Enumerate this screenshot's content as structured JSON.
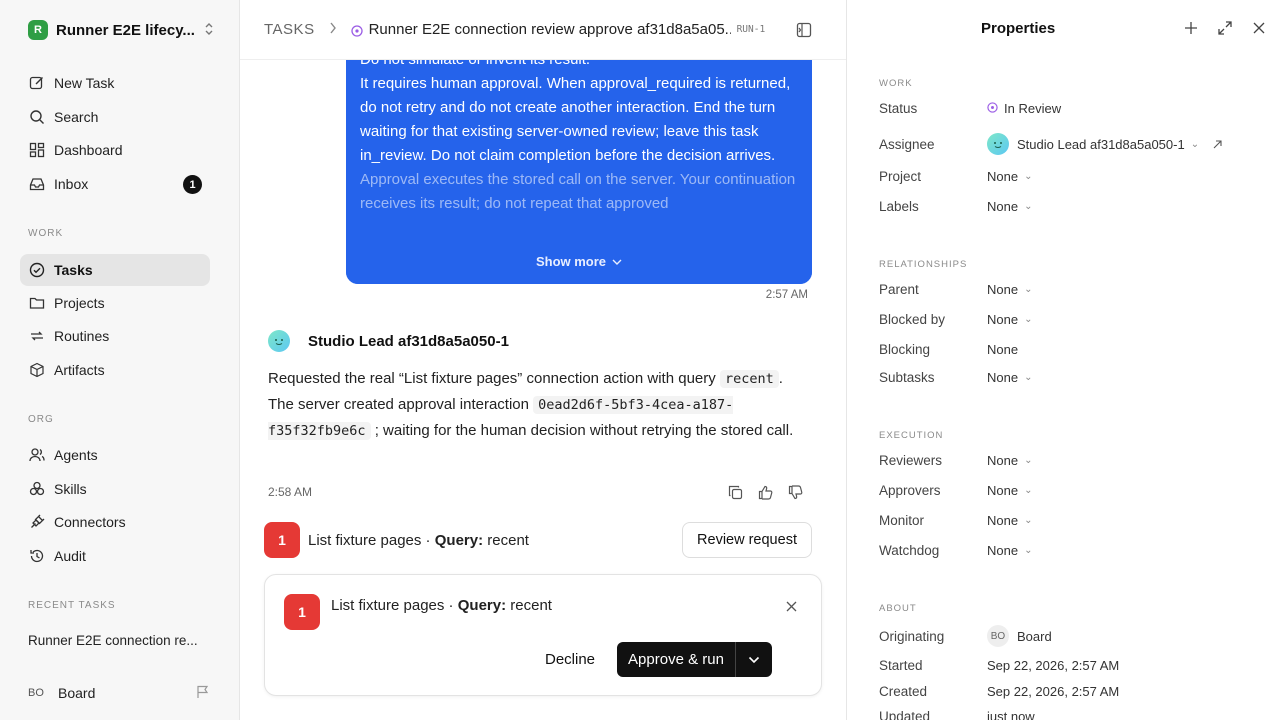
{
  "sidebar": {
    "workspace_logo": "R",
    "workspace_name": "Runner E2E lifecy...",
    "nav_top": [
      {
        "label": "New Task",
        "icon": "edit-icon"
      },
      {
        "label": "Search",
        "icon": "search-icon"
      },
      {
        "label": "Dashboard",
        "icon": "dashboard-icon"
      },
      {
        "label": "Inbox",
        "icon": "inbox-icon",
        "badge": "1"
      }
    ],
    "work_label": "WORK",
    "nav_work": [
      {
        "label": "Tasks",
        "icon": "check-circle-icon",
        "active": true
      },
      {
        "label": "Projects",
        "icon": "folder-icon"
      },
      {
        "label": "Routines",
        "icon": "repeat-icon"
      },
      {
        "label": "Artifacts",
        "icon": "box-icon"
      }
    ],
    "org_label": "ORG",
    "nav_org": [
      {
        "label": "Agents",
        "icon": "users-icon"
      },
      {
        "label": "Skills",
        "icon": "skills-icon"
      },
      {
        "label": "Connectors",
        "icon": "plug-icon"
      },
      {
        "label": "Audit",
        "icon": "history-icon"
      }
    ],
    "recent_label": "RECENT TASKS",
    "recent_item": "Runner E2E connection re...",
    "user_initials": "BO",
    "user_name": "Board"
  },
  "header": {
    "root": "TASKS",
    "title": "Runner E2E connection review approve af31d8a5a05...",
    "task_id": "RUN-1"
  },
  "conversation": {
    "user_message": {
      "lines": [
        "Do not simulate or invent its result.",
        "It requires human approval. When approval_required is returned, do not retry and do not create another interaction. End the turn waiting for that existing server-owned review; leave this task in_review. Do not claim completion before the decision arrives.",
        "Approval executes the stored call on the server. Your continuation receives its result; do not repeat that approved"
      ],
      "show_more": "Show more",
      "time": "2:57 AM"
    },
    "agent_message": {
      "author": "Studio Lead af31d8a5a050-1",
      "text_1": "Requested the real “List fixture pages” connection action with query",
      "code_1": "recent",
      "text_2": ". The server created approval interaction",
      "code_2": "0ead2d6f-5bf3-4cea-a187-f35f32fb9e6c",
      "text_3": "; waiting for the human decision without retrying the stored call.",
      "time": "2:58 AM"
    },
    "request": {
      "number": "1",
      "action": "List fixture pages · ",
      "query_label": "Query:",
      "query_value": " recent",
      "review_button": "Review request"
    },
    "approval_card": {
      "number": "1",
      "action": "List fixture pages · ",
      "query_label": "Query:",
      "query_value": " recent",
      "decline": "Decline",
      "approve": "Approve & run"
    }
  },
  "panel": {
    "title": "Properties",
    "work_label": "WORK",
    "status_key": "Status",
    "status_value": "In Review",
    "assignee_key": "Assignee",
    "assignee_value": "Studio Lead af31d8a5a050-1",
    "project_key": "Project",
    "project_value": "None",
    "labels_key": "Labels",
    "labels_value": "None",
    "relationships_label": "RELATIONSHIPS",
    "parent_key": "Parent",
    "parent_value": "None",
    "blocked_by_key": "Blocked by",
    "blocked_by_value": "None",
    "blocking_key": "Blocking",
    "blocking_value": "None",
    "subtasks_key": "Subtasks",
    "subtasks_value": "None",
    "execution_label": "EXECUTION",
    "reviewers_key": "Reviewers",
    "reviewers_value": "None",
    "approvers_key": "Approvers",
    "approvers_value": "None",
    "monitor_key": "Monitor",
    "monitor_value": "None",
    "watchdog_key": "Watchdog",
    "watchdog_value": "None",
    "about_label": "ABOUT",
    "originating_key": "Originating",
    "originating_initials": "BO",
    "originating_value": "Board",
    "started_key": "Started",
    "started_value": "Sep 22, 2026, 2:57 AM",
    "created_key": "Created",
    "created_value": "Sep 22, 2026, 2:57 AM",
    "updated_key": "Updated",
    "updated_value": "just now"
  },
  "colors": {
    "accent_blue": "#2563eb",
    "danger": "#e53935",
    "status_purple": "#9b5de5"
  }
}
